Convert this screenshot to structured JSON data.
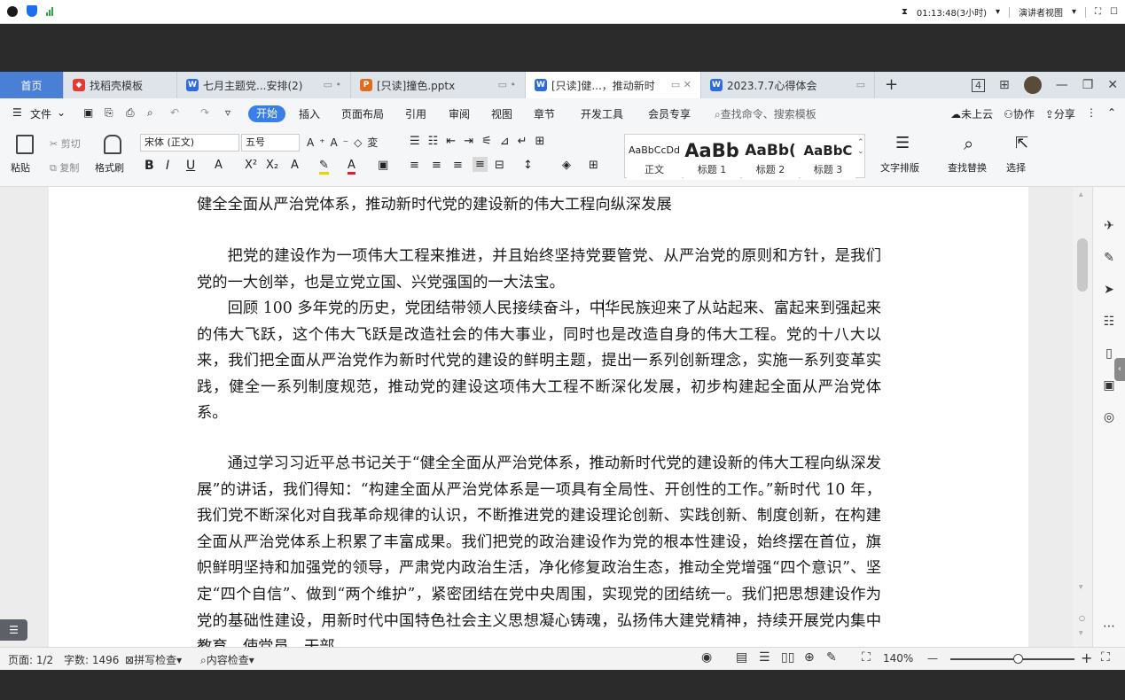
{
  "system_bar": {
    "timer": "01:13:48(3小时)",
    "presenter_view": "演讲者视图"
  },
  "tabs": [
    {
      "label": "首页"
    },
    {
      "label": "找稻壳模板"
    },
    {
      "label": "七月主题党...安排(2)"
    },
    {
      "label": "[只读]撞色.pptx"
    },
    {
      "label": "[只读]健...，推动新时"
    },
    {
      "label": "2023.7.7心得体会"
    }
  ],
  "tab_add": "+",
  "tab_right": {
    "page_count_icon": "4"
  },
  "menu": {
    "file": "文件",
    "items": [
      "开始",
      "插入",
      "页面布局",
      "引用",
      "审阅",
      "视图",
      "章节",
      "开发工具",
      "会员专享"
    ],
    "search": "查找命令、搜索模板",
    "right": [
      "未上云",
      "协作",
      "分享"
    ]
  },
  "toolbar": {
    "paste": "粘贴",
    "cut": "剪切",
    "copy": "复制",
    "format_painter": "格式刷",
    "font": "宋体 (正文)",
    "size": "五号",
    "styles": [
      {
        "preview": "AaBbCcDd",
        "label": "正文"
      },
      {
        "preview": "AaBb",
        "label": "标题 1"
      },
      {
        "preview": "AaBb(",
        "label": "标题 2"
      },
      {
        "preview": "AaBbC",
        "label": "标题 3"
      }
    ],
    "text_layout": "文字排版",
    "find_replace": "查找替换",
    "select": "选择"
  },
  "document": {
    "heading": "健全全面从严治党体系，推动新时代党的建设新的伟大工程向纵深发展",
    "p1": "把党的建设作为一项伟大工程来推进，并且始终坚持党要管党、从严治党的原则和方针，是我们党的一大创举，也是立党立国、兴党强国的一大法宝。",
    "p2": "回顾 100 多年党的历史，党团结带领人民接续奋斗，中华民族迎来了从站起来、富起来到强起来的伟大飞跃，这个伟大飞跃是改造社会的伟大事业，同时也是改造自身的伟大工程。党的十八大以来，我们把全面从严治党作为新时代党的建设的鲜明主题，提出一系列创新理念，实施一系列变革实践，健全一系列制度规范，推动党的建设这项伟大工程不断深化发展，初步构建起全面从严治党体系。",
    "p3": "通过学习习近平总书记关于“健全全面从严治党体系，推动新时代党的建设新的伟大工程向纵深发展”的讲话，我们得知：“构建全面从严治党体系是一项具有全局性、开创性的工作。”新时代 10 年，我们党不断深化对自我革命规律的认识，不断推进党的建设理论创新、实践创新、制度创新，在构建全面从严治党体系上积累了丰富成果。我们把党的政治建设作为党的根本性建设，始终摆在首位，旗帜鲜明坚持和加强党的领导，严肃党内政治生活，净化修复政治生态，推动全党增强“四个意识”、坚定“四个自信”、做到“两个维护”，紧密团结在党中央周围，实现党的团结统一。我们把思想建设作为党的基础性建设，用新时代中国特色社会主义思想凝心铸魂，弘扬伟大建党精神，持续开展党内集中教育，使党员、干部"
  },
  "status": {
    "page": "页面: 1/2",
    "words": "字数: 1496",
    "spell": "拼写检查",
    "content": "内容检查",
    "zoom": "140%",
    "zoom_fraction": 0.55
  }
}
